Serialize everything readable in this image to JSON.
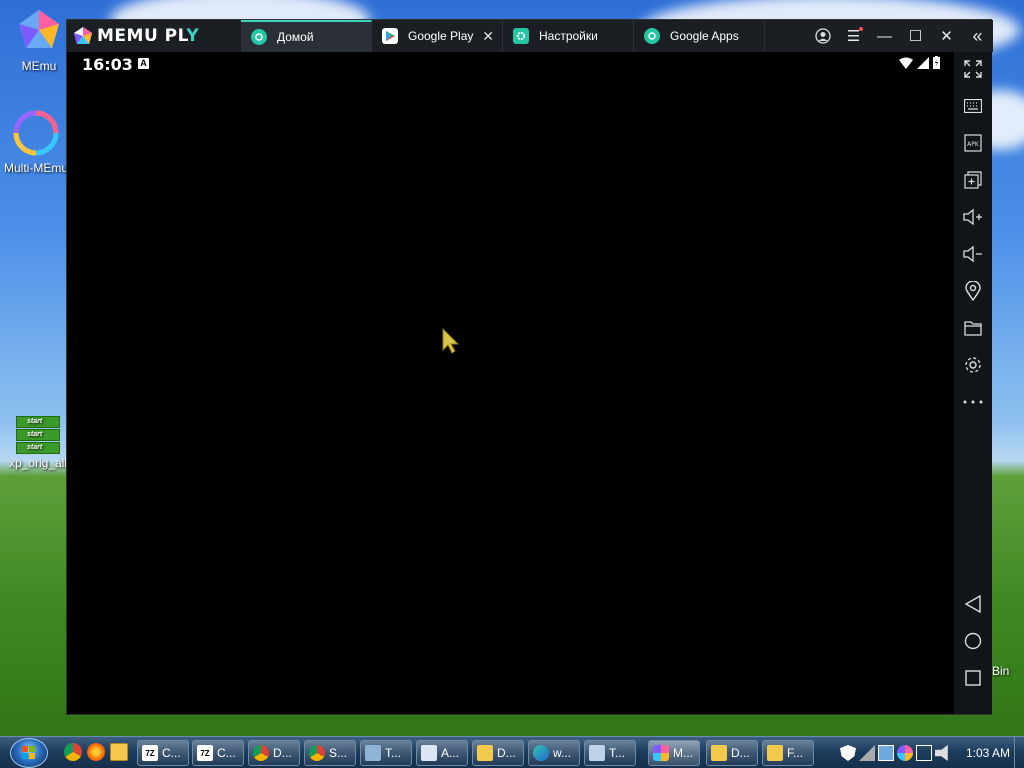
{
  "desktop": {
    "icons": [
      {
        "label": "MEmu"
      },
      {
        "label": "Multi-MEmu"
      },
      {
        "label": "xp_orig_all"
      }
    ],
    "xp_thumb_text": "start",
    "recycle_bin_label": "Bin"
  },
  "window": {
    "brand": "MEMU PL",
    "brand_tail": "Y",
    "tabs": [
      {
        "label": "Домой",
        "active": true,
        "icon": "memu-home-icon",
        "color": "#25c6a6"
      },
      {
        "label": "Google Play",
        "active": false,
        "icon": "google-play-icon",
        "closable": true,
        "close_glyph": "✕"
      },
      {
        "label": "Настройки",
        "active": false,
        "icon": "settings-gear-icon",
        "color": "#25c6a6"
      },
      {
        "label": "Google Apps",
        "active": false,
        "icon": "google-apps-icon",
        "color": "#25c6a6"
      }
    ],
    "title_buttons": [
      {
        "name": "account-icon"
      },
      {
        "name": "menu-icon",
        "glyph": "☰"
      },
      {
        "name": "minimize-icon",
        "glyph": "—"
      },
      {
        "name": "maximize-icon",
        "glyph": "☐"
      },
      {
        "name": "close-icon",
        "glyph": "✕"
      },
      {
        "name": "collapse-sidebar-icon",
        "glyph": "«"
      }
    ],
    "accent": "#3ad1c0"
  },
  "android": {
    "clock": "16:03",
    "notification_badge": "A"
  },
  "sidebar": {
    "tools": [
      {
        "name": "fullscreen-icon",
        "apk_label": ""
      },
      {
        "name": "keyboard-icon"
      },
      {
        "name": "apk-install-icon",
        "apk_label": "APK"
      },
      {
        "name": "multi-window-icon"
      },
      {
        "name": "volume-up-icon"
      },
      {
        "name": "volume-down-icon"
      },
      {
        "name": "location-icon"
      },
      {
        "name": "folder-icon"
      },
      {
        "name": "settings-icon"
      },
      {
        "name": "more-icon"
      }
    ],
    "nav": [
      {
        "name": "back-icon"
      },
      {
        "name": "home-icon"
      },
      {
        "name": "recents-icon"
      }
    ]
  },
  "taskbar": {
    "pinned": [
      {
        "name": "chrome-icon"
      },
      {
        "name": "firefox-icon"
      },
      {
        "name": "explorer-icon"
      }
    ],
    "tasks": [
      {
        "label": "C...",
        "icon": "7zip-icon",
        "icon_text": "7Z"
      },
      {
        "label": "C...",
        "icon": "7zip-icon",
        "icon_text": "7Z"
      },
      {
        "label": "D...",
        "icon": "chrome-icon"
      },
      {
        "label": "S...",
        "icon": "chrome-icon"
      },
      {
        "label": "T...",
        "icon": "app-icon"
      },
      {
        "label": "A...",
        "icon": "document-icon"
      },
      {
        "label": "D...",
        "icon": "folder-icon"
      },
      {
        "label": "w...",
        "icon": "edge-icon"
      },
      {
        "label": "T...",
        "icon": "monitor-icon"
      },
      {
        "label": "M...",
        "icon": "memu-icon",
        "active": true
      },
      {
        "label": "D...",
        "icon": "folder-icon"
      },
      {
        "label": "F...",
        "icon": "folder-icon"
      }
    ],
    "clock": "1:03 AM"
  }
}
